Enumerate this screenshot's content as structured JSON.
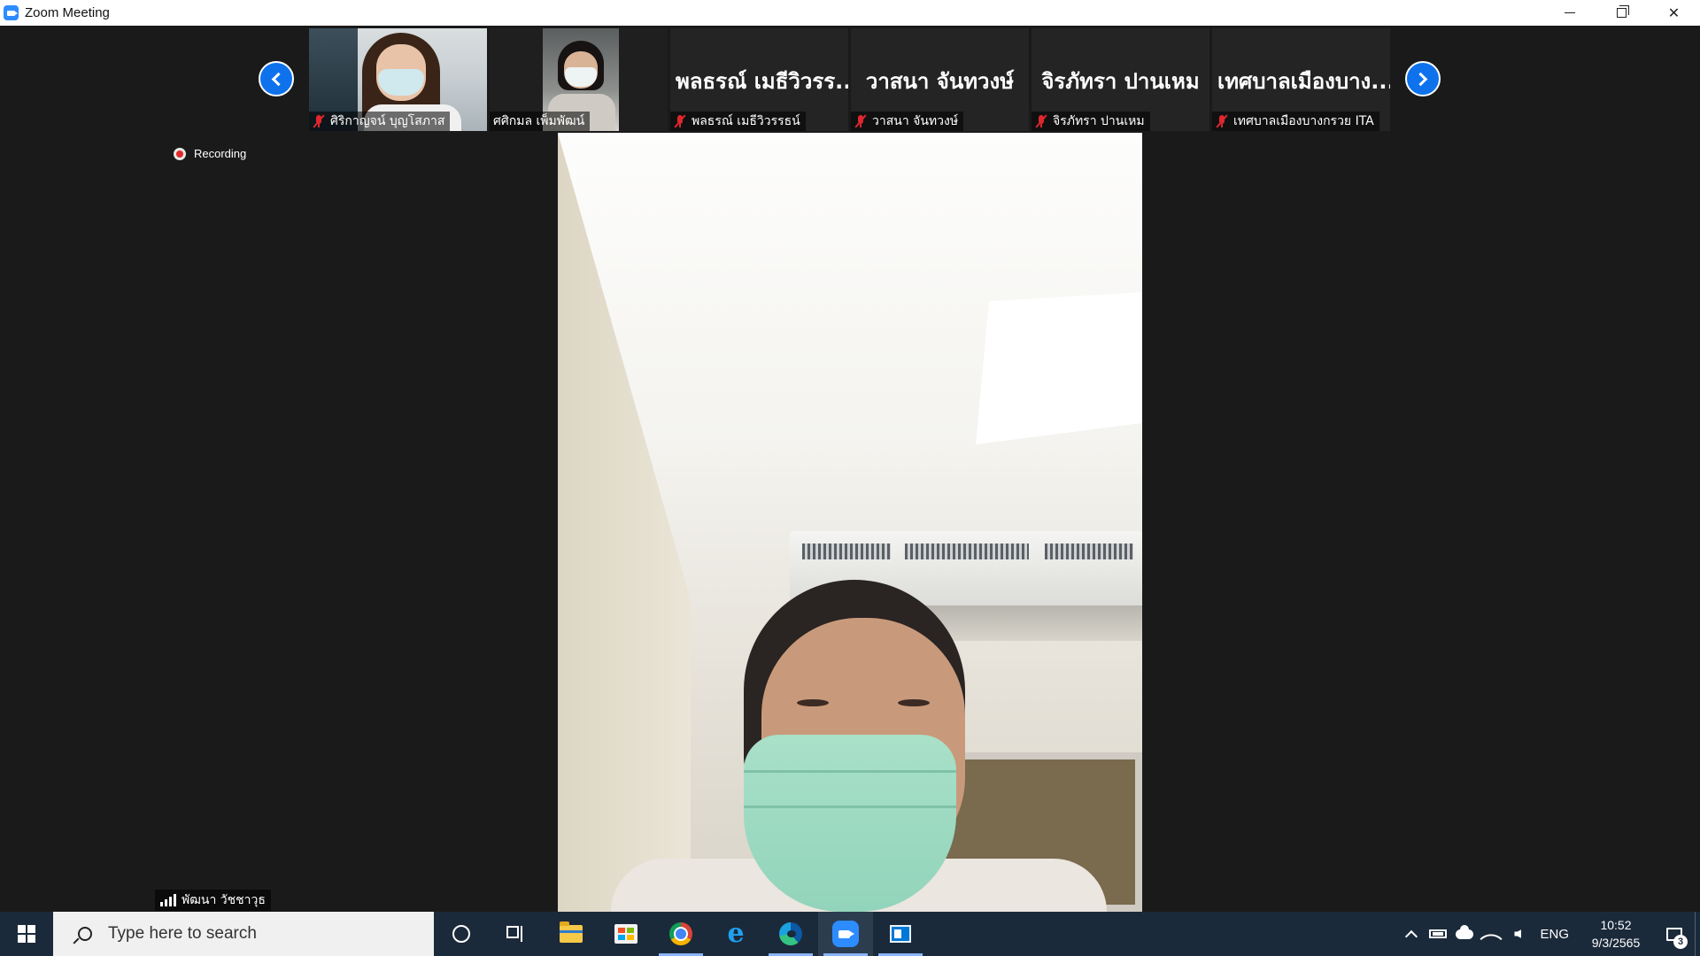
{
  "window": {
    "title": "Zoom Meeting"
  },
  "gallery": {
    "participants": [
      {
        "name": "ศิริกาญจน์ บุญโสภาส",
        "display_name": "",
        "video": true,
        "muted": true
      },
      {
        "name": "ศศิกมล เพ็มพัฒน์",
        "display_name": "",
        "video": true,
        "muted": false
      },
      {
        "name": "พลธรณ์ เมธีวิวรรธน์",
        "display_name": "พลธรณ์ เมธีวิวรร...",
        "video": false,
        "muted": true
      },
      {
        "name": "วาสนา จันทวงษ์",
        "display_name": "วาสนา จันทวงษ์",
        "video": false,
        "muted": true
      },
      {
        "name": "จิรภัทรา ปานเหม",
        "display_name": "จิรภัทรา ปานเหม",
        "video": false,
        "muted": true
      },
      {
        "name": "เทศบาลเมืองบางกรวย ITA",
        "display_name": "เทศบาลเมืองบาง...",
        "video": false,
        "muted": true
      }
    ]
  },
  "recording": {
    "label": "Recording"
  },
  "active_speaker": {
    "name": "พัฒนา วัชชาวุธ"
  },
  "taskbar": {
    "search_placeholder": "Type here to search",
    "language": "ENG",
    "time": "10:52",
    "date": "9/3/2565",
    "notification_count": "3"
  },
  "colors": {
    "accent": "#0e72ed",
    "muted_mic": "#e0272d",
    "taskbar": "#1b2a3a",
    "meeting_bg": "#1a1a1a"
  }
}
